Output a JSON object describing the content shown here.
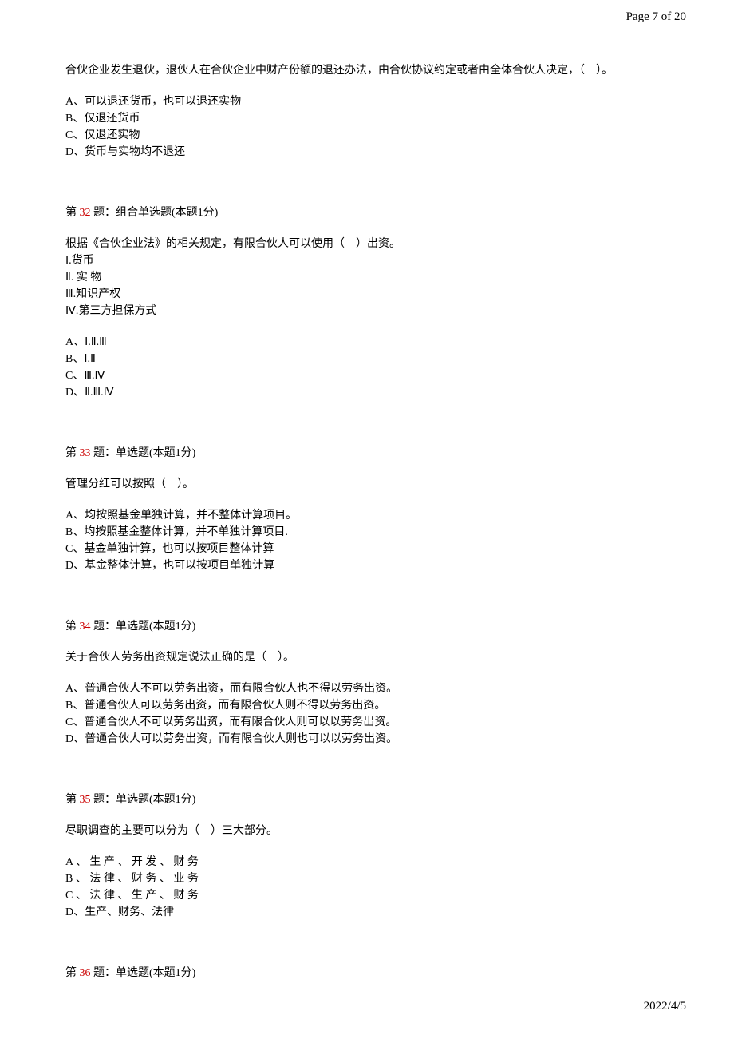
{
  "header": {
    "page_info": "Page 7 of 20"
  },
  "q31": {
    "stem": "合伙企业发生退伙，退伙人在合伙企业中财产份额的退还办法，由合伙协议约定或者由全体合伙人决定，（　）。",
    "optA": "A、可以退还货币，也可以退还实物",
    "optB": "B、仅退还货币",
    "optC": "C、仅退还实物",
    "optD": "D、货币与实物均不退还"
  },
  "q32": {
    "prefix": "第 ",
    "num": "32",
    "suffix": " 题：组合单选题(本题1分)",
    "stem": "根据《合伙企业法》的相关规定，有限合伙人可以使用（　）出资。",
    "line1": "Ⅰ.货币",
    "line2": "Ⅱ. 实 物",
    "line3": "Ⅲ.知识产权",
    "line4": "Ⅳ.第三方担保方式",
    "optA": "A、Ⅰ.Ⅱ.Ⅲ",
    "optB": "B、Ⅰ.Ⅱ",
    "optC": "C、Ⅲ.Ⅳ",
    "optD": "D、Ⅱ.Ⅲ.Ⅳ"
  },
  "q33": {
    "prefix": "第 ",
    "num": "33",
    "suffix": " 题：单选题(本题1分)",
    "stem": "管理分红可以按照（　）。",
    "optA": "A、均按照基金单独计算，并不整体计算项目。",
    "optB": "B、均按照基金整体计算，并不单独计算项目.",
    "optC": "C、基金单独计算，也可以按项目整体计算",
    "optD": "D、基金整体计算，也可以按项目单独计算"
  },
  "q34": {
    "prefix": "第 ",
    "num": "34",
    "suffix": " 题：单选题(本题1分)",
    "stem": "关于合伙人劳务出资规定说法正确的是（　）。",
    "optA": "A、普通合伙人不可以劳务出资，而有限合伙人也不得以劳务出资。",
    "optB": "B、普通合伙人可以劳务出资，而有限合伙人则不得以劳务出资。",
    "optC": "C、普通合伙人不可以劳务出资，而有限合伙人则可以以劳务出资。",
    "optD": "D、普通合伙人可以劳务出资，而有限合伙人则也可以以劳务出资。"
  },
  "q35": {
    "prefix": "第 ",
    "num": "35",
    "suffix": " 题：单选题(本题1分)",
    "stem": "尽职调查的主要可以分为（　）三大部分。",
    "optA": "A 、 生 产 、 开 发 、 财 务",
    "optB": "B 、 法 律 、 财 务 、 业 务",
    "optC": "C 、 法 律 、 生 产 、 财 务",
    "optD": "D、生产、财务、法律"
  },
  "q36": {
    "prefix": "第 ",
    "num": "36",
    "suffix": " 题：单选题(本题1分)"
  },
  "footer": {
    "date": "2022/4/5"
  }
}
